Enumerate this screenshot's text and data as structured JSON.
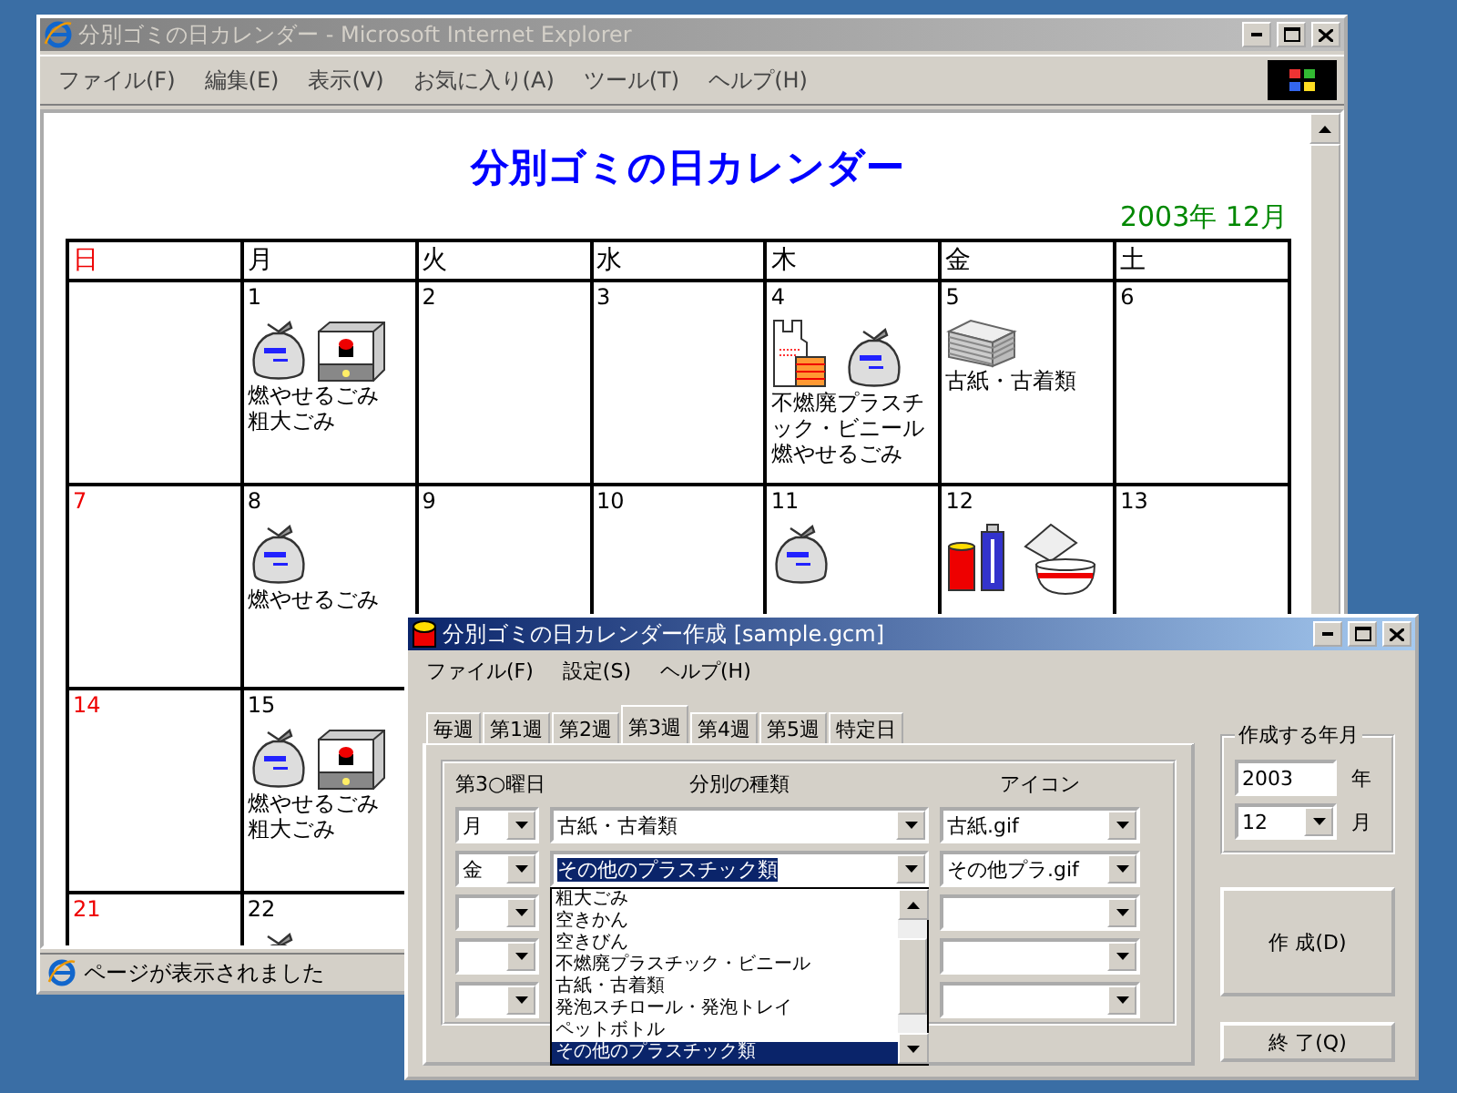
{
  "browser": {
    "title": "分別ゴミの日カレンダー - Microsoft Internet Explorer",
    "menu": [
      "ファイル(F)",
      "編集(E)",
      "表示(V)",
      "お気に入り(A)",
      "ツール(T)",
      "ヘルプ(H)"
    ],
    "page": {
      "heading": "分別ゴミの日カレンダー",
      "month": "2003年 12月",
      "weekdays": [
        {
          "label": "日",
          "holiday": true
        },
        {
          "label": "月",
          "holiday": false
        },
        {
          "label": "火",
          "holiday": false
        },
        {
          "label": "水",
          "holiday": false
        },
        {
          "label": "木",
          "holiday": false
        },
        {
          "label": "金",
          "holiday": false
        },
        {
          "label": "土",
          "holiday": false
        }
      ],
      "weeks": [
        {
          "mon": {
            "day": "1",
            "icons": [
              {
                "kind": "bag"
              },
              {
                "kind": "bulky"
              }
            ],
            "labels": [
              "燃やせるごみ",
              "粗大ごみ"
            ]
          },
          "tue": {
            "day": "2"
          },
          "wed": {
            "day": "3"
          },
          "thu": {
            "day": "4",
            "icons": [
              {
                "kind": "plastic"
              },
              {
                "kind": "bag"
              }
            ],
            "labels": [
              "不燃廃プラスチック・ビニール",
              "燃やせるごみ"
            ]
          },
          "fri": {
            "day": "5",
            "icons": [
              {
                "kind": "paper"
              }
            ],
            "labels": [
              "古紙・古着類"
            ]
          },
          "sat": {
            "day": "6"
          }
        },
        {
          "sun": {
            "day": "7",
            "holiday": true
          },
          "mon": {
            "day": "8",
            "icons": [
              {
                "kind": "bag"
              }
            ],
            "labels": [
              "燃やせるごみ"
            ]
          },
          "tue": {
            "day": "9"
          },
          "wed": {
            "day": "10"
          },
          "thu": {
            "day": "11",
            "icons": [
              {
                "kind": "bag"
              }
            ]
          },
          "fri": {
            "day": "12",
            "icons": [
              {
                "kind": "cans"
              }
            ]
          },
          "sat": {
            "day": "13"
          }
        },
        {
          "sun": {
            "day": "14",
            "holiday": true
          },
          "mon": {
            "day": "15",
            "icons": [
              {
                "kind": "bag"
              },
              {
                "kind": "bulky"
              }
            ],
            "labels": [
              "燃やせるごみ",
              "粗大ごみ"
            ]
          }
        },
        {
          "sun": {
            "day": "21",
            "holiday": true
          },
          "mon": {
            "day": "22",
            "icons": [
              {
                "kind": "bag"
              }
            ]
          }
        }
      ]
    },
    "status": "ページが表示されました"
  },
  "dialog": {
    "title": "分別ゴミの日カレンダー作成 [sample.gcm]",
    "menu": [
      "ファイル(F)",
      "設定(S)",
      "ヘルプ(H)"
    ],
    "tabs": [
      {
        "label": "毎週",
        "selected": false
      },
      {
        "label": "第1週",
        "selected": false
      },
      {
        "label": "第2週",
        "selected": false
      },
      {
        "label": "第3週",
        "selected": true
      },
      {
        "label": "第4週",
        "selected": false
      },
      {
        "label": "第5週",
        "selected": false
      },
      {
        "label": "特定日",
        "selected": false
      }
    ],
    "columns": [
      "第3○曜日",
      "分別の種類",
      "アイコン"
    ],
    "rows": [
      {
        "weekday": "月",
        "kind": "古紙・古着類",
        "icon": "古紙.gif",
        "selected": false
      },
      {
        "weekday": "金",
        "kind": "その他のプラスチック類",
        "icon": "その他プラ.gif",
        "selected": true,
        "open": true
      },
      {},
      {},
      {}
    ],
    "dropdown": [
      {
        "label": "粗大ごみ",
        "selected": false
      },
      {
        "label": "空きかん",
        "selected": false
      },
      {
        "label": "空きびん",
        "selected": false
      },
      {
        "label": "不燃廃プラスチック・ビニール",
        "selected": false
      },
      {
        "label": "古紙・古着類",
        "selected": false
      },
      {
        "label": "発泡スチロール・発泡トレイ",
        "selected": false
      },
      {
        "label": "ペットボトル",
        "selected": false
      },
      {
        "label": "その他のプラスチック類",
        "selected": true
      }
    ],
    "period": {
      "title": "作成する年月",
      "year": "2003",
      "year_unit": "年",
      "month": "12",
      "month_unit": "月"
    },
    "buttons": [
      "作 成(D)",
      "終 了(Q)"
    ]
  }
}
